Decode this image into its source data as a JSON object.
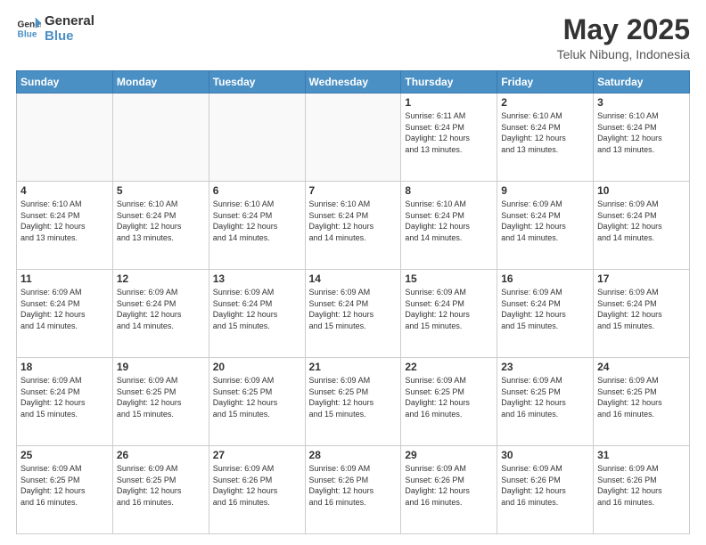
{
  "logo": {
    "line1": "General",
    "line2": "Blue"
  },
  "title": "May 2025",
  "subtitle": "Teluk Nibung, Indonesia",
  "weekdays": [
    "Sunday",
    "Monday",
    "Tuesday",
    "Wednesday",
    "Thursday",
    "Friday",
    "Saturday"
  ],
  "weeks": [
    [
      {
        "day": "",
        "info": ""
      },
      {
        "day": "",
        "info": ""
      },
      {
        "day": "",
        "info": ""
      },
      {
        "day": "",
        "info": ""
      },
      {
        "day": "1",
        "info": "Sunrise: 6:11 AM\nSunset: 6:24 PM\nDaylight: 12 hours\nand 13 minutes."
      },
      {
        "day": "2",
        "info": "Sunrise: 6:10 AM\nSunset: 6:24 PM\nDaylight: 12 hours\nand 13 minutes."
      },
      {
        "day": "3",
        "info": "Sunrise: 6:10 AM\nSunset: 6:24 PM\nDaylight: 12 hours\nand 13 minutes."
      }
    ],
    [
      {
        "day": "4",
        "info": "Sunrise: 6:10 AM\nSunset: 6:24 PM\nDaylight: 12 hours\nand 13 minutes."
      },
      {
        "day": "5",
        "info": "Sunrise: 6:10 AM\nSunset: 6:24 PM\nDaylight: 12 hours\nand 13 minutes."
      },
      {
        "day": "6",
        "info": "Sunrise: 6:10 AM\nSunset: 6:24 PM\nDaylight: 12 hours\nand 14 minutes."
      },
      {
        "day": "7",
        "info": "Sunrise: 6:10 AM\nSunset: 6:24 PM\nDaylight: 12 hours\nand 14 minutes."
      },
      {
        "day": "8",
        "info": "Sunrise: 6:10 AM\nSunset: 6:24 PM\nDaylight: 12 hours\nand 14 minutes."
      },
      {
        "day": "9",
        "info": "Sunrise: 6:09 AM\nSunset: 6:24 PM\nDaylight: 12 hours\nand 14 minutes."
      },
      {
        "day": "10",
        "info": "Sunrise: 6:09 AM\nSunset: 6:24 PM\nDaylight: 12 hours\nand 14 minutes."
      }
    ],
    [
      {
        "day": "11",
        "info": "Sunrise: 6:09 AM\nSunset: 6:24 PM\nDaylight: 12 hours\nand 14 minutes."
      },
      {
        "day": "12",
        "info": "Sunrise: 6:09 AM\nSunset: 6:24 PM\nDaylight: 12 hours\nand 14 minutes."
      },
      {
        "day": "13",
        "info": "Sunrise: 6:09 AM\nSunset: 6:24 PM\nDaylight: 12 hours\nand 15 minutes."
      },
      {
        "day": "14",
        "info": "Sunrise: 6:09 AM\nSunset: 6:24 PM\nDaylight: 12 hours\nand 15 minutes."
      },
      {
        "day": "15",
        "info": "Sunrise: 6:09 AM\nSunset: 6:24 PM\nDaylight: 12 hours\nand 15 minutes."
      },
      {
        "day": "16",
        "info": "Sunrise: 6:09 AM\nSunset: 6:24 PM\nDaylight: 12 hours\nand 15 minutes."
      },
      {
        "day": "17",
        "info": "Sunrise: 6:09 AM\nSunset: 6:24 PM\nDaylight: 12 hours\nand 15 minutes."
      }
    ],
    [
      {
        "day": "18",
        "info": "Sunrise: 6:09 AM\nSunset: 6:24 PM\nDaylight: 12 hours\nand 15 minutes."
      },
      {
        "day": "19",
        "info": "Sunrise: 6:09 AM\nSunset: 6:25 PM\nDaylight: 12 hours\nand 15 minutes."
      },
      {
        "day": "20",
        "info": "Sunrise: 6:09 AM\nSunset: 6:25 PM\nDaylight: 12 hours\nand 15 minutes."
      },
      {
        "day": "21",
        "info": "Sunrise: 6:09 AM\nSunset: 6:25 PM\nDaylight: 12 hours\nand 15 minutes."
      },
      {
        "day": "22",
        "info": "Sunrise: 6:09 AM\nSunset: 6:25 PM\nDaylight: 12 hours\nand 16 minutes."
      },
      {
        "day": "23",
        "info": "Sunrise: 6:09 AM\nSunset: 6:25 PM\nDaylight: 12 hours\nand 16 minutes."
      },
      {
        "day": "24",
        "info": "Sunrise: 6:09 AM\nSunset: 6:25 PM\nDaylight: 12 hours\nand 16 minutes."
      }
    ],
    [
      {
        "day": "25",
        "info": "Sunrise: 6:09 AM\nSunset: 6:25 PM\nDaylight: 12 hours\nand 16 minutes."
      },
      {
        "day": "26",
        "info": "Sunrise: 6:09 AM\nSunset: 6:25 PM\nDaylight: 12 hours\nand 16 minutes."
      },
      {
        "day": "27",
        "info": "Sunrise: 6:09 AM\nSunset: 6:26 PM\nDaylight: 12 hours\nand 16 minutes."
      },
      {
        "day": "28",
        "info": "Sunrise: 6:09 AM\nSunset: 6:26 PM\nDaylight: 12 hours\nand 16 minutes."
      },
      {
        "day": "29",
        "info": "Sunrise: 6:09 AM\nSunset: 6:26 PM\nDaylight: 12 hours\nand 16 minutes."
      },
      {
        "day": "30",
        "info": "Sunrise: 6:09 AM\nSunset: 6:26 PM\nDaylight: 12 hours\nand 16 minutes."
      },
      {
        "day": "31",
        "info": "Sunrise: 6:09 AM\nSunset: 6:26 PM\nDaylight: 12 hours\nand 16 minutes."
      }
    ]
  ]
}
